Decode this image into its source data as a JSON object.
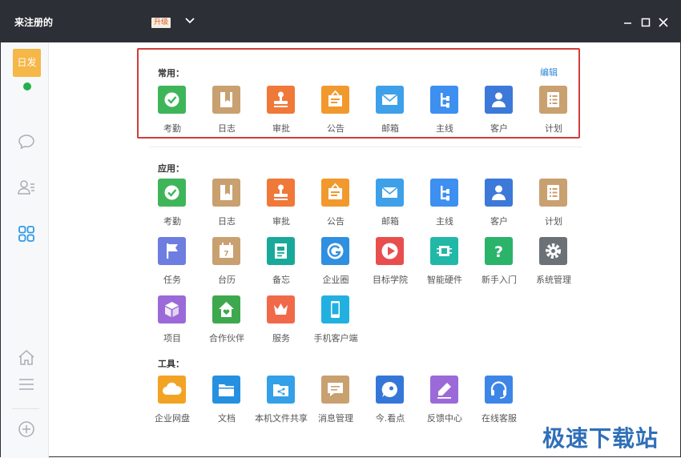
{
  "titlebar": {
    "title": "来注册的",
    "upgrade_label": "升级"
  },
  "sidebar": {
    "avatar_text": "日发",
    "active_item": "apps-grid-icon"
  },
  "sections": {
    "frequent_label": "常用：",
    "apps_label": "应用：",
    "tools_label": "工具：",
    "edit_label": "编辑"
  },
  "frequent": [
    {
      "label": "考勤",
      "color": "#3fb55a",
      "icon": "check-circle-icon"
    },
    {
      "label": "日志",
      "color": "#c9a070",
      "icon": "notebook-icon"
    },
    {
      "label": "审批",
      "color": "#f07838",
      "icon": "stamp-icon"
    },
    {
      "label": "公告",
      "color": "#f2992e",
      "icon": "notice-board-icon"
    },
    {
      "label": "邮箱",
      "color": "#3da0e8",
      "icon": "envelope-icon"
    },
    {
      "label": "主线",
      "color": "#3d8ff0",
      "icon": "tree-branch-icon"
    },
    {
      "label": "客户",
      "color": "#3c79d8",
      "icon": "person-icon"
    },
    {
      "label": "计划",
      "color": "#c9a070",
      "icon": "checklist-icon"
    }
  ],
  "apps_row1": [
    {
      "label": "考勤",
      "color": "#3fb55a",
      "icon": "check-circle-icon"
    },
    {
      "label": "日志",
      "color": "#c9a070",
      "icon": "notebook-icon"
    },
    {
      "label": "审批",
      "color": "#f07838",
      "icon": "stamp-icon"
    },
    {
      "label": "公告",
      "color": "#f2992e",
      "icon": "notice-board-icon"
    },
    {
      "label": "邮箱",
      "color": "#3da0e8",
      "icon": "envelope-icon"
    },
    {
      "label": "主线",
      "color": "#3d8ff0",
      "icon": "tree-branch-icon"
    },
    {
      "label": "客户",
      "color": "#3c79d8",
      "icon": "person-icon"
    },
    {
      "label": "计划",
      "color": "#c9a070",
      "icon": "checklist-icon"
    }
  ],
  "apps_row2": [
    {
      "label": "任务",
      "color": "#6d7ee0",
      "icon": "flag-icon"
    },
    {
      "label": "台历",
      "color": "#c9a070",
      "icon": "calendar-icon"
    },
    {
      "label": "备忘",
      "color": "#19a99a",
      "icon": "memo-icon"
    },
    {
      "label": "企业圈",
      "color": "#2f8fe0",
      "icon": "g-circle-icon"
    },
    {
      "label": "目标学院",
      "color": "#e94e4e",
      "icon": "play-icon"
    },
    {
      "label": "智能硬件",
      "color": "#22b8a8",
      "icon": "chip-icon"
    },
    {
      "label": "新手入门",
      "color": "#2bb36a",
      "icon": "question-icon"
    },
    {
      "label": "系统管理",
      "color": "#6b7177",
      "icon": "gear-icon"
    }
  ],
  "apps_row3": [
    {
      "label": "项目",
      "color": "#9b6ad8",
      "icon": "cube-icon"
    },
    {
      "label": "合作伙伴",
      "color": "#3ea84e",
      "icon": "house-heart-icon"
    },
    {
      "label": "服务",
      "color": "#f06a4a",
      "icon": "crown-icon"
    },
    {
      "label": "手机客户端",
      "color": "#22b0e0",
      "icon": "phone-icon"
    }
  ],
  "tools": [
    {
      "label": "企业网盘",
      "color": "#f2a323",
      "icon": "cloud-icon"
    },
    {
      "label": "文档",
      "color": "#2590e0",
      "icon": "folder-icon"
    },
    {
      "label": "本机文件共享",
      "color": "#33a0e8",
      "icon": "shared-folder-icon"
    },
    {
      "label": "消息管理",
      "color": "#c9a070",
      "icon": "message-icon"
    },
    {
      "label": "今.看点",
      "color": "#3577d8",
      "icon": "eye-bubble-icon"
    },
    {
      "label": "反馈中心",
      "color": "#9b6ad8",
      "icon": "pen-icon"
    },
    {
      "label": "在线客服",
      "color": "#3d86e8",
      "icon": "headset-icon"
    }
  ],
  "watermark": "极速下载站"
}
